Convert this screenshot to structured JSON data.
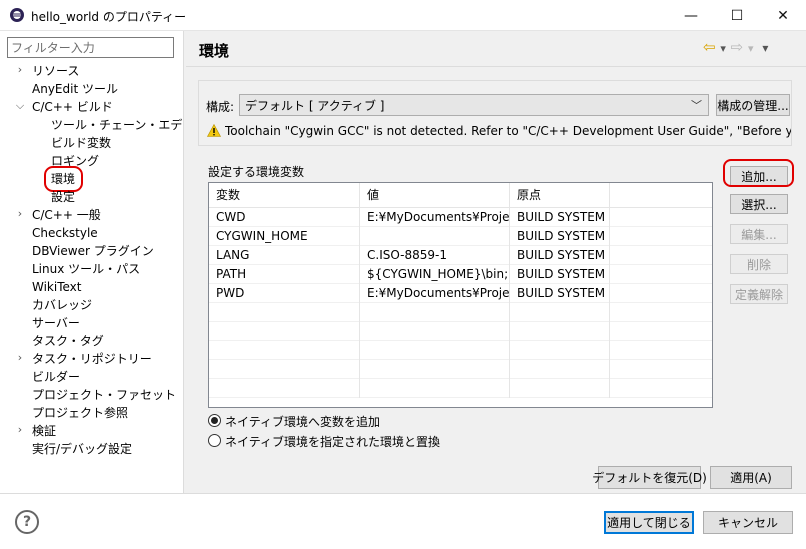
{
  "window": {
    "title": "hello_world のプロパティー",
    "minimize_glyph": "—",
    "maximize_glyph": "☐",
    "close_glyph": "✕"
  },
  "filter": {
    "placeholder": "フィルター入力"
  },
  "tree": [
    {
      "label": "リソース",
      "expandable": true,
      "expanded": false,
      "level": 0
    },
    {
      "label": "AnyEdit ツール",
      "expandable": false,
      "level": 0
    },
    {
      "label": "C/C++ ビルド",
      "expandable": true,
      "expanded": true,
      "level": 0
    },
    {
      "label": "ツール・チェーン・エディター",
      "expandable": false,
      "level": 1
    },
    {
      "label": "ビルド変数",
      "expandable": false,
      "level": 1
    },
    {
      "label": "ロギング",
      "expandable": false,
      "level": 1
    },
    {
      "label": "環境",
      "expandable": false,
      "level": 1,
      "selected": true
    },
    {
      "label": "設定",
      "expandable": false,
      "level": 1
    },
    {
      "label": "C/C++ 一般",
      "expandable": true,
      "expanded": false,
      "level": 0
    },
    {
      "label": "Checkstyle",
      "expandable": false,
      "level": 0
    },
    {
      "label": "DBViewer プラグイン",
      "expandable": false,
      "level": 0
    },
    {
      "label": "Linux ツール・パス",
      "expandable": false,
      "level": 0
    },
    {
      "label": "WikiText",
      "expandable": false,
      "level": 0
    },
    {
      "label": "カバレッジ",
      "expandable": false,
      "level": 0
    },
    {
      "label": "サーバー",
      "expandable": false,
      "level": 0
    },
    {
      "label": "タスク・タグ",
      "expandable": false,
      "level": 0
    },
    {
      "label": "タスク・リポジトリー",
      "expandable": true,
      "expanded": false,
      "level": 0
    },
    {
      "label": "ビルダー",
      "expandable": false,
      "level": 0
    },
    {
      "label": "プロジェクト・ファセット",
      "expandable": false,
      "level": 0
    },
    {
      "label": "プロジェクト参照",
      "expandable": false,
      "level": 0
    },
    {
      "label": "検証",
      "expandable": true,
      "expanded": false,
      "level": 0
    },
    {
      "label": "実行/デバッグ設定",
      "expandable": false,
      "level": 0
    }
  ],
  "page": {
    "title": "環境",
    "nav": {
      "back": "⇦",
      "back_menu": "▾",
      "forward": "⇨",
      "forward_menu": "▾",
      "view_menu": "▾"
    },
    "config_label": "構成:",
    "config_value": "デフォルト [ アクティブ ]",
    "manage_config": "構成の管理...",
    "warning": "Toolchain \"Cygwin GCC\" is not detected. Refer to \"C/C++ Development User Guide\", \"Before you begin\" hov",
    "env_label": "設定する環境変数",
    "table": {
      "columns": [
        "変数",
        "値",
        "原点"
      ],
      "rows": [
        [
          "CWD",
          "E:¥MyDocuments¥Proje...",
          "BUILD SYSTEM"
        ],
        [
          "CYGWIN_HOME",
          "",
          "BUILD SYSTEM"
        ],
        [
          "LANG",
          "C.ISO-8859-1",
          "BUILD SYSTEM"
        ],
        [
          "PATH",
          "${CYGWIN_HOME}\\bin;...",
          "BUILD SYSTEM"
        ],
        [
          "PWD",
          "E:¥MyDocuments¥Proje...",
          "BUILD SYSTEM"
        ]
      ]
    },
    "buttons": {
      "add": "追加...",
      "select": "選択...",
      "edit": "編集...",
      "delete": "削除",
      "undefine": "定義解除"
    },
    "radio_append": "ネイティブ環境へ変数を追加",
    "radio_replace": "ネイティブ環境を指定された環境と置換",
    "restore_defaults": "デフォルトを復元(D)",
    "apply": "適用(A)"
  },
  "footer": {
    "help": "?",
    "apply_close": "適用して閉じる",
    "cancel": "キャンセル"
  },
  "colors": {
    "highlight_ring": "#e00000",
    "accent": "#0078d7",
    "warning": "#f2c811"
  }
}
